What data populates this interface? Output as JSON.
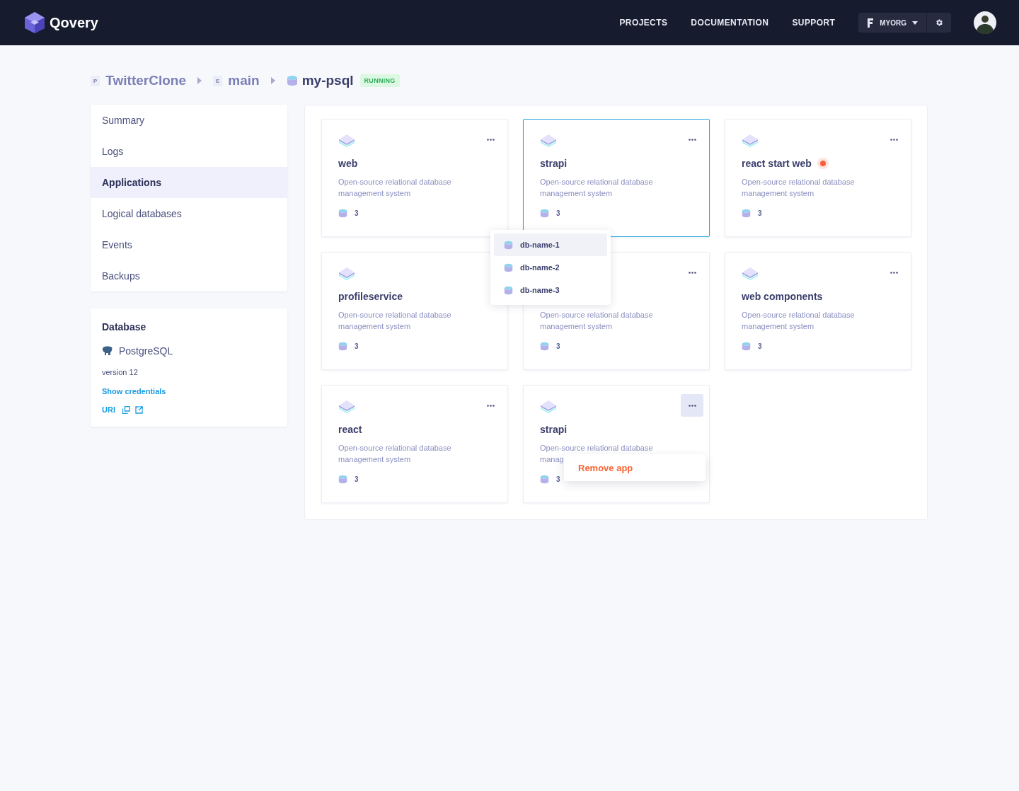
{
  "nav": {
    "brand": "Qovery",
    "links": [
      "PROJECTS",
      "DOCUMENTATION",
      "SUPPORT"
    ],
    "org": "MYORG"
  },
  "breadcrumb": [
    {
      "kind": "project",
      "badge": "P",
      "label": "TwitterClone"
    },
    {
      "kind": "env",
      "badge": "E",
      "label": "main"
    },
    {
      "kind": "db",
      "label": "my-psql",
      "status": "RUNNING"
    }
  ],
  "sidebar": {
    "items": [
      {
        "label": "Summary",
        "selected": false
      },
      {
        "label": "Logs",
        "selected": false
      },
      {
        "label": "Applications",
        "selected": true
      },
      {
        "label": "Logical databases",
        "selected": false
      },
      {
        "label": "Events",
        "selected": false
      },
      {
        "label": "Backups",
        "selected": false
      }
    ]
  },
  "database": {
    "title": "Database",
    "engine": "PostgreSQL",
    "version": "version 12",
    "credentials_link": "Show credentials",
    "uri_label": "URI"
  },
  "apps": [
    {
      "name": "web",
      "description": "Open-source relational database management system",
      "count": "3",
      "selected": false,
      "show_icon": true,
      "show_menu": true,
      "menu_open": false
    },
    {
      "name": "strapi",
      "description": "Open-source relational database management system",
      "count": "3",
      "selected": true,
      "show_icon": true,
      "show_menu": true,
      "menu_open": false
    },
    {
      "name": "react start web",
      "color": "#f7603c",
      "description": "Open-source relational database management system",
      "count": "3",
      "selected": false,
      "show_icon": true,
      "show_menu": true,
      "menu_open": false
    },
    {
      "name": "profileservice",
      "description": "Open-source relational database management system",
      "count": "3",
      "selected": false,
      "show_icon": true,
      "show_menu": false,
      "menu_open": false
    },
    {
      "description": "Open-source relational database management system",
      "count": "3",
      "selected": false,
      "show_icon": false,
      "show_menu": true,
      "menu_open": false
    },
    {
      "name": "web components",
      "description": "Open-source relational database management system",
      "count": "3",
      "selected": false,
      "show_icon": true,
      "show_menu": true,
      "menu_open": false
    },
    {
      "name": "react",
      "description": "Open-source relational database management system",
      "count": "3",
      "selected": false,
      "show_icon": true,
      "show_menu": true,
      "menu_open": false
    },
    {
      "name": "strapi",
      "description": "Open-source relational database manag",
      "count": "3",
      "selected": false,
      "show_icon": true,
      "show_menu": true,
      "menu_open": true
    }
  ],
  "db_menu": {
    "items": [
      {
        "label": "db-name-1",
        "selected": true
      },
      {
        "label": "db-name-2",
        "selected": false
      },
      {
        "label": "db-name-3",
        "selected": false
      }
    ]
  },
  "app_menu": {
    "items": [
      "Remove app"
    ]
  }
}
